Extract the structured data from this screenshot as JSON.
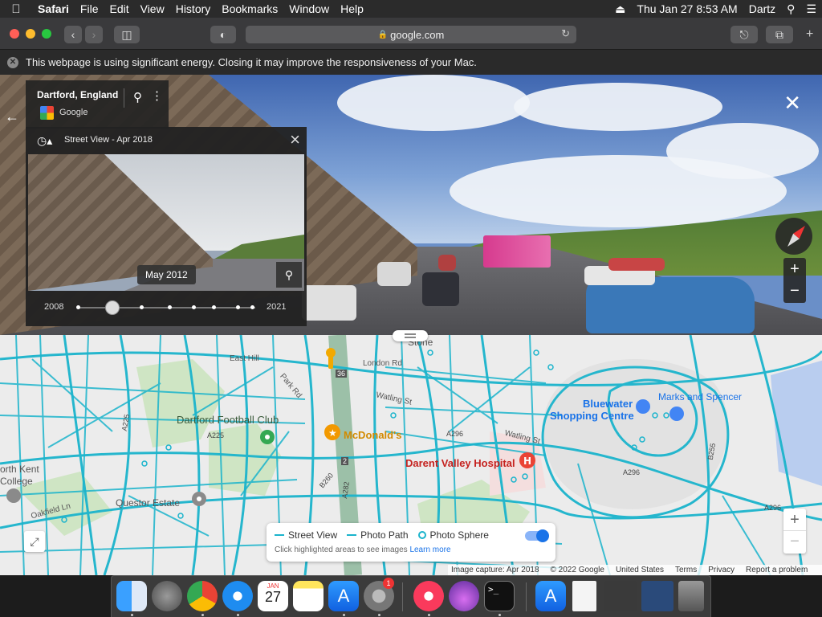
{
  "menubar": {
    "app": "Safari",
    "items": [
      "File",
      "Edit",
      "View",
      "History",
      "Bookmarks",
      "Window",
      "Help"
    ],
    "datetime": "Thu Jan 27  8:53 AM",
    "user": "Dartz"
  },
  "toolbar": {
    "url": "google.com"
  },
  "banner": {
    "text": "This webpage is using significant energy. Closing it may improve the responsiveness of your Mac."
  },
  "streetview": {
    "place_name": "Dartford, England",
    "provider": "Google",
    "time_panel_title": "Street View - Apr 2018",
    "thumb_date": "May 2012",
    "year_start": "2008",
    "year_end": "2021",
    "timeline_position": 0.2
  },
  "map": {
    "labels": {
      "stone": "Stone",
      "london_rd": "London Rd",
      "east_hill": "East Hill",
      "park_rd": "Park Rd",
      "watling_st": "Watling St",
      "watling_st2": "Watling St",
      "dartford_fc": "Dartford Football Club",
      "mcdonalds": "McDonald's",
      "a225": "A225",
      "a225b": "A225",
      "a296": "A296",
      "a296b": "A296",
      "a296c": "A296",
      "a282": "A282",
      "b260": "B260",
      "b255": "B255",
      "hospital": "Darent Valley Hospital",
      "bluewater": "Bluewater",
      "shopping": "Shopping Centre",
      "marks": "Marks and Spencer",
      "kent": "orth Kent",
      "college": "College",
      "oakfield": "Oakfield Ln",
      "questor": "Questor Estate",
      "r36": "36",
      "r2": "2"
    },
    "legend": {
      "street_view": "Street View",
      "photo_path": "Photo Path",
      "photo_sphere": "Photo Sphere",
      "hint": "Click highlighted areas to see images",
      "learn_more": "Learn more"
    },
    "footer": {
      "capture": "Image capture: Apr 2018",
      "copyright": "© 2022 Google",
      "region": "United States",
      "terms": "Terms",
      "privacy": "Privacy",
      "report": "Report a problem"
    }
  },
  "dock": {
    "calendar_month": "JAN",
    "calendar_day": "27",
    "badge": "1"
  },
  "colors": {
    "street_view_blue": "#1bb4cc",
    "map_bg": "#e8e8e8"
  }
}
